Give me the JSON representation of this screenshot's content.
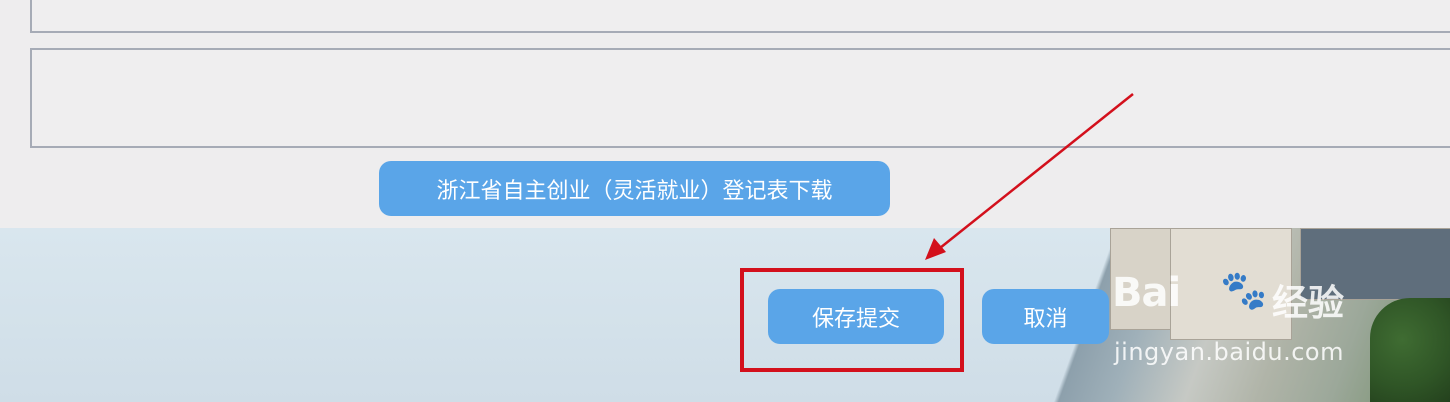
{
  "form": {
    "download_button": "浙江省自主创业（灵活就业）登记表下载"
  },
  "actions": {
    "submit_button": "保存提交",
    "cancel_button": "取消"
  },
  "watermark": {
    "logo_text": "Bai",
    "logo_paw": "du",
    "logo_cn": "经验",
    "url": "jingyan.baidu.com"
  },
  "colors": {
    "button": "#5aa5e8",
    "highlight": "#d3101c",
    "arrow": "#d3101c"
  }
}
